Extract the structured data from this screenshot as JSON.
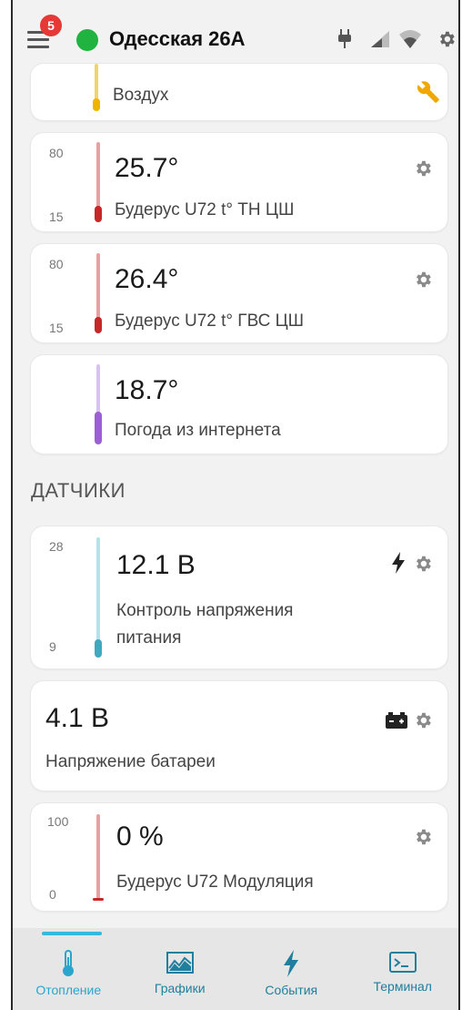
{
  "header": {
    "notification_count": "5",
    "location": "Одесская 26А",
    "status_color": "#21b33f"
  },
  "cards": [
    {
      "label": "Воздух",
      "icon": "wrench-icon"
    },
    {
      "max": "80",
      "min": "15",
      "value": "25.7°",
      "label": "Будерус U72 t° ТН ЦШ"
    },
    {
      "max": "80",
      "min": "15",
      "value": "26.4°",
      "label": "Будерус U72 t° ГВС ЦШ"
    },
    {
      "value": "18.7°",
      "label": "Погода из интернета"
    }
  ],
  "section": {
    "title": "ДАТЧИКИ"
  },
  "sensors": [
    {
      "max": "28",
      "min": "9",
      "value": "12.1 В",
      "label_line1": "Контроль напряжения",
      "label_line2": "питания",
      "icon": "lightning-icon"
    },
    {
      "value": "4.1 В",
      "label": "Напряжение батареи",
      "icon": "battery-icon"
    },
    {
      "max": "100",
      "min": "0",
      "value": "0 %",
      "label": "Будерус U72 Модуляция"
    }
  ],
  "nav": [
    {
      "label": "Отопление",
      "icon": "thermometer-icon",
      "active": true
    },
    {
      "label": "Графики",
      "icon": "chart-icon"
    },
    {
      "label": "События",
      "icon": "lightning-icon"
    },
    {
      "label": "Терминал",
      "icon": "terminal-icon"
    }
  ],
  "colors": {
    "accent": "#2aa5cc",
    "gear": "#8a8a8a",
    "wrench": "#f0a800",
    "thermo_red": "#c62828",
    "thermo_red_light": "#e8a0a0",
    "thermo_purple": "#9c5fd6",
    "thermo_purple_light": "#d9c2f2",
    "thermo_teal": "#3fa9bf",
    "thermo_teal_light": "#b3e2ea"
  }
}
